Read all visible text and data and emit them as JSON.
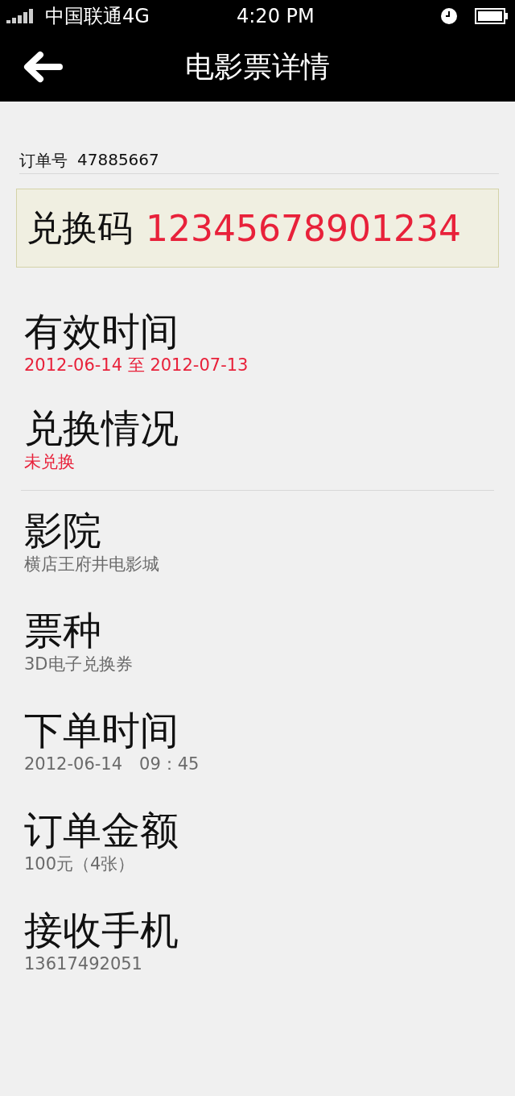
{
  "status_bar": {
    "carrier": "中国联通4G",
    "time": "4:20 PM"
  },
  "nav": {
    "title": "电影票详情"
  },
  "order": {
    "label": "订单号",
    "value": "47885667"
  },
  "code": {
    "label": "兑换码",
    "value": "12345678901234"
  },
  "status_items": [
    {
      "label": "有效时间",
      "value": "2012-06-14 至 2012-07-13",
      "color": "#e8213a"
    },
    {
      "label": "兑换情况",
      "value": "未兑换",
      "color": "#e8213a"
    }
  ],
  "detail_items": [
    {
      "label": "影院",
      "value": "横店王府井电影城",
      "color": "#6a6a6a"
    },
    {
      "label": "票种",
      "value": "3D电子兑换券",
      "color": "#6a6a6a"
    },
    {
      "label": "下单时间",
      "value": "2012-06-14　09：45",
      "color": "#6a6a6a"
    },
    {
      "label": "订单金额",
      "value": "100元（4张）",
      "color": "#6a6a6a"
    },
    {
      "label": "接收手机",
      "value": "13617492051",
      "color": "#6a6a6a"
    }
  ]
}
